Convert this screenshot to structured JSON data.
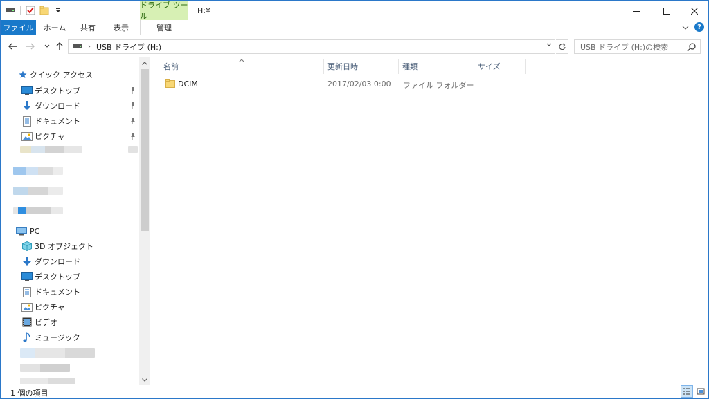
{
  "window": {
    "title": "H:¥",
    "context_tab_label": "ドライブ ツール"
  },
  "ribbon": {
    "tabs": [
      {
        "label": "ファイル"
      },
      {
        "label": "ホーム"
      },
      {
        "label": "共有"
      },
      {
        "label": "表示"
      },
      {
        "label": "管理"
      }
    ]
  },
  "address_bar": {
    "path": "USB ドライブ (H:)",
    "search_placeholder": "USB ドライブ (H:)の検索"
  },
  "nav_pane": {
    "quick_access": {
      "label": "クイック アクセス",
      "items": [
        {
          "label": "デスクトップ",
          "icon": "desktop-icon",
          "pinned": true
        },
        {
          "label": "ダウンロード",
          "icon": "download-icon",
          "pinned": true
        },
        {
          "label": "ドキュメント",
          "icon": "document-icon",
          "pinned": true
        },
        {
          "label": "ピクチャ",
          "icon": "pictures-icon",
          "pinned": true
        }
      ]
    },
    "pc": {
      "label": "PC",
      "items": [
        {
          "label": "3D オブジェクト",
          "icon": "3d-objects-icon"
        },
        {
          "label": "ダウンロード",
          "icon": "download-icon"
        },
        {
          "label": "デスクトップ",
          "icon": "desktop-icon"
        },
        {
          "label": "ドキュメント",
          "icon": "document-icon"
        },
        {
          "label": "ピクチャ",
          "icon": "pictures-icon"
        },
        {
          "label": "ビデオ",
          "icon": "video-icon"
        },
        {
          "label": "ミュージック",
          "icon": "music-icon"
        }
      ]
    }
  },
  "content": {
    "columns": [
      {
        "label": "名前"
      },
      {
        "label": "更新日時"
      },
      {
        "label": "種類"
      },
      {
        "label": "サイズ"
      }
    ],
    "rows": [
      {
        "name": "DCIM",
        "modified": "2017/02/03 0:00",
        "type": "ファイル フォルダー",
        "size": ""
      }
    ]
  },
  "status_bar": {
    "item_count": "1 個の項目"
  },
  "colors": {
    "accent": "#1979ca",
    "context_tab_bg": "#d7f0b4",
    "folder": "#f8d775"
  }
}
